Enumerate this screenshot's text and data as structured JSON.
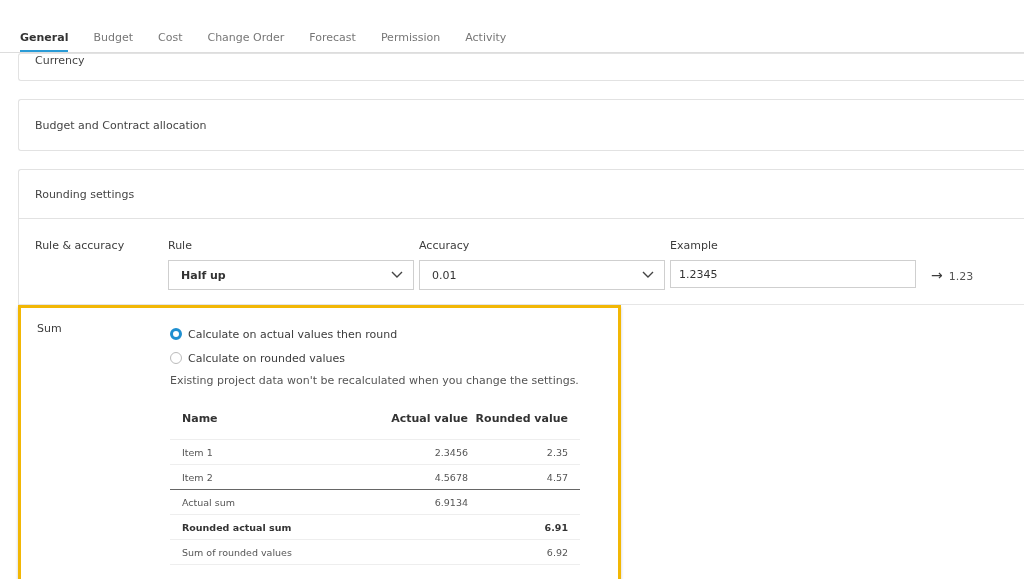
{
  "tabs": [
    {
      "label": "General",
      "selected": true
    },
    {
      "label": "Budget",
      "selected": false
    },
    {
      "label": "Cost",
      "selected": false
    },
    {
      "label": "Change Order",
      "selected": false
    },
    {
      "label": "Forecast",
      "selected": false
    },
    {
      "label": "Permission",
      "selected": false
    },
    {
      "label": "Activity",
      "selected": false
    }
  ],
  "sections": [
    {
      "title": "Currency"
    },
    {
      "title": "Budget and Contract allocation"
    }
  ],
  "rounding": {
    "title": "Rounding settings",
    "rule_row": {
      "label": "Rule & accuracy",
      "rule": {
        "label": "Rule",
        "value": "Half up"
      },
      "accuracy": {
        "label": "Accuracy",
        "value": "0.01"
      },
      "example": {
        "label": "Example",
        "value": "1.2345"
      },
      "arrow": "→",
      "result": "1.23"
    },
    "sum": {
      "label": "Sum",
      "highlighted": true,
      "options": [
        {
          "label": "Calculate on actual values then round",
          "selected": true
        },
        {
          "label": "Calculate on rounded values",
          "selected": false
        }
      ],
      "note": "Existing project data won't be recalculated when you change the settings.",
      "table": {
        "columns": [
          "Name",
          "Actual value",
          "Rounded value"
        ],
        "rows": [
          {
            "kind": "item",
            "cells": [
              "Item 1",
              "2.3456",
              "2.35"
            ]
          },
          {
            "kind": "item",
            "cells": [
              "Item 2",
              "4.5678",
              "4.57"
            ]
          },
          {
            "kind": "total",
            "cells": [
              "Actual sum",
              "6.9134",
              ""
            ]
          },
          {
            "kind": "emphasis",
            "cells": [
              "Rounded actual sum",
              "",
              "6.91"
            ]
          },
          {
            "kind": "plain",
            "cells": [
              "Sum of rounded values",
              "",
              "6.92"
            ]
          }
        ]
      }
    }
  }
}
